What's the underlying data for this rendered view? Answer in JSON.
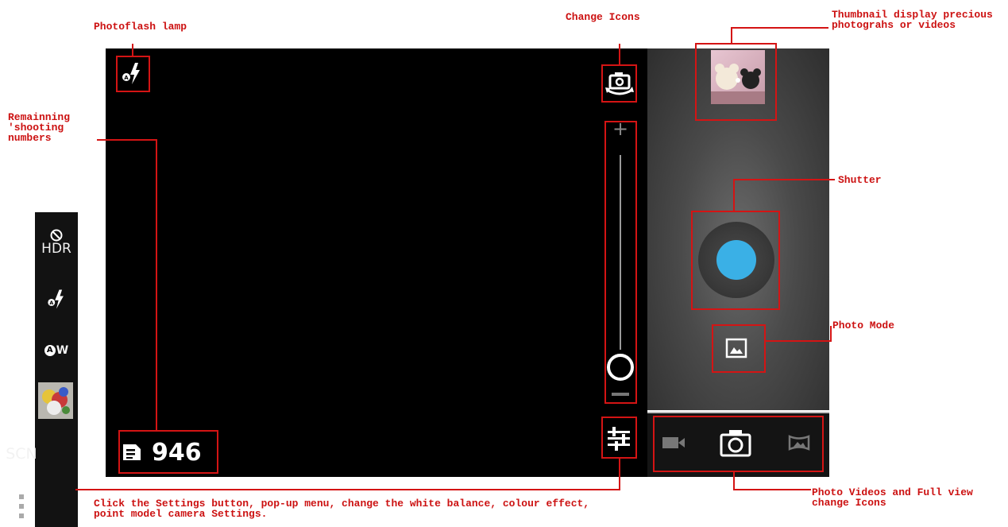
{
  "annotations": {
    "photoflash_lamp": "Photoflash lamp",
    "change_icons": "Change Icons",
    "thumbnail_display": "Thumbnail display precious\nphotograhs or videos",
    "remaining_shots": "Remainning\n'shooting\nnumbers",
    "shutter": "Shutter",
    "photo_mode": "Photo Mode",
    "mode_switch": "Photo Videos and Full view\nchange Icons",
    "settings_note": "Click the Settings button, pop-up menu, change the white balance, colour effect,\npoint model camera Settings."
  },
  "camera": {
    "remaining_count": "946",
    "zoom_plus": "+",
    "zoom_minus": "−",
    "zoom_level": 0.0
  },
  "sidebar": {
    "hdr_label": "HDR",
    "white_balance_label": "W",
    "scene_label": "SCN"
  },
  "icons": [
    "flash-auto-icon",
    "switch-camera-icon",
    "settings-sliders-icon",
    "document-icon",
    "video-icon",
    "camera-icon",
    "panorama-icon",
    "photo-mode-icon",
    "hdr-off-icon",
    "white-balance-auto-icon",
    "more-icon"
  ],
  "colors": {
    "annotation": "#cc1111",
    "shutter_blue": "#3ab0e6"
  }
}
